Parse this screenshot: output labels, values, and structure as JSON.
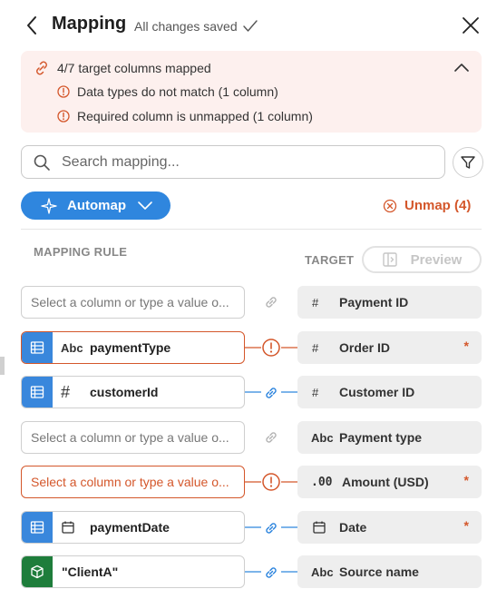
{
  "header": {
    "title": "Mapping",
    "status": "All changes saved"
  },
  "alert": {
    "summary": "4/7 target columns mapped",
    "issues": [
      "Data types do not match (1 column)",
      "Required column is unmapped (1 column)"
    ]
  },
  "search": {
    "placeholder": "Search mapping..."
  },
  "toolbar": {
    "automap_label": "Automap",
    "unmap_label": "Unmap (4)"
  },
  "columns": {
    "rule_header": "MAPPING RULE",
    "target_header": "TARGET",
    "preview_label": "Preview"
  },
  "rows": [
    {
      "source_placeholder": "Select a column or type a value o...",
      "source_type": "",
      "source_name": "",
      "link_state": "unlinked",
      "target_type": "#",
      "target_name": "Payment ID",
      "required": ""
    },
    {
      "source_placeholder": "",
      "source_type": "Abc",
      "source_name": "paymentType",
      "link_state": "error",
      "target_type": "#",
      "target_name": "Order ID",
      "required": "*"
    },
    {
      "source_placeholder": "",
      "source_type": "#",
      "source_name": "customerId",
      "link_state": "linked",
      "target_type": "#",
      "target_name": "Customer ID",
      "required": ""
    },
    {
      "source_placeholder": "Select a column or type a value o...",
      "source_type": "",
      "source_name": "",
      "link_state": "unlinked",
      "target_type": "Abc",
      "target_name": "Payment type",
      "required": ""
    },
    {
      "source_placeholder": "Select a column or type a value o...",
      "source_type": "",
      "source_name": "",
      "link_state": "error",
      "target_type": ".00",
      "target_name": "Amount (USD)",
      "required": "*"
    },
    {
      "source_placeholder": "",
      "source_type": "calendar-icon",
      "source_name": "paymentDate",
      "link_state": "linked",
      "target_type": "calendar-icon",
      "target_name": "Date",
      "required": "*"
    },
    {
      "source_placeholder": "",
      "source_type": "",
      "source_name": "\"ClientA\"",
      "link_state": "linked",
      "target_type": "Abc",
      "target_name": "Source name",
      "required": ""
    }
  ],
  "colors": {
    "accent": "#2f86de",
    "error": "#d4572b",
    "alert_bg": "#fdf0ee",
    "target_bg": "#eeeeee",
    "constant": "#1e7d3b"
  }
}
